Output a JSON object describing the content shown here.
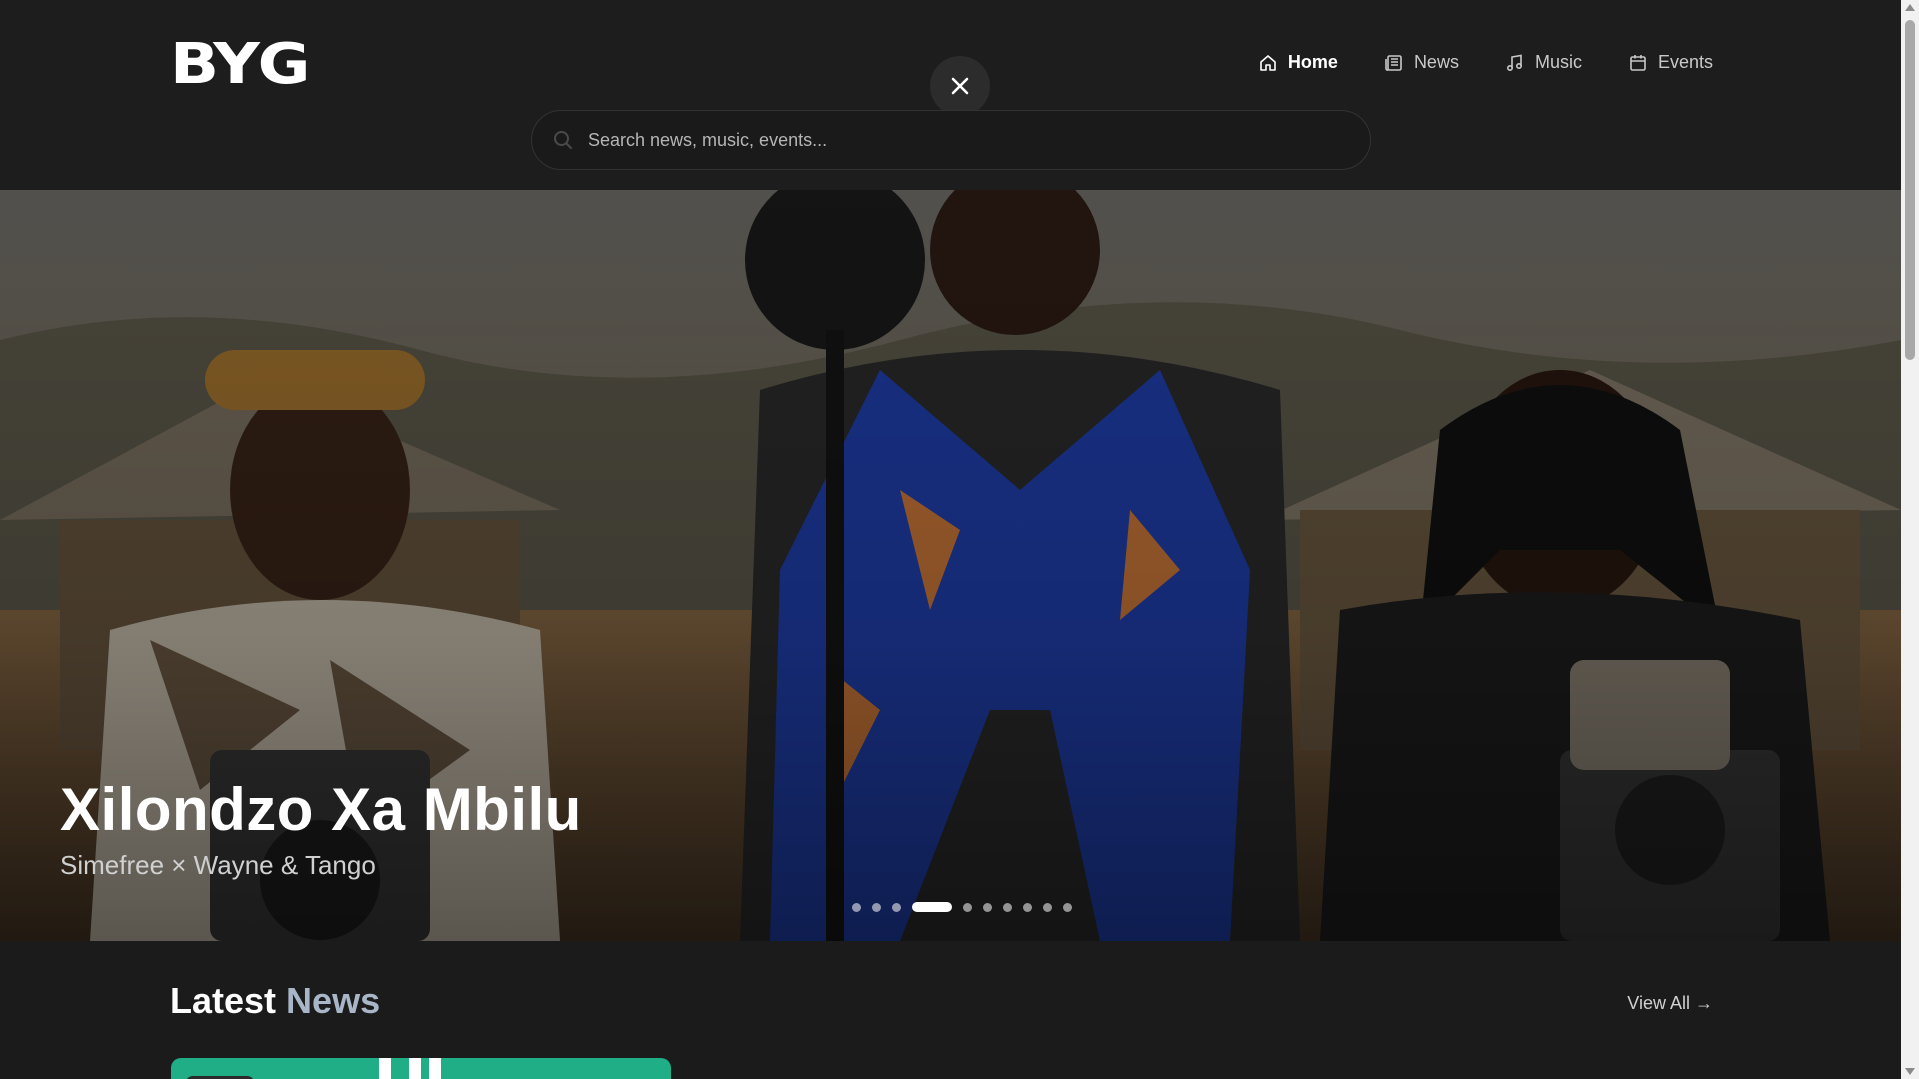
{
  "brand": {
    "logo": "BYG"
  },
  "nav": {
    "items": [
      {
        "label": "Home",
        "icon": "home-icon",
        "active": true
      },
      {
        "label": "News",
        "icon": "newspaper-icon",
        "active": false
      },
      {
        "label": "Music",
        "icon": "music-note-icon",
        "active": false
      },
      {
        "label": "Events",
        "icon": "calendar-icon",
        "active": false
      }
    ]
  },
  "search": {
    "placeholder": "Search news, music, events...",
    "value": ""
  },
  "hero": {
    "title": "Xilondzo Xa Mbilu",
    "subtitle": "Simefree × Wayne & Tango",
    "slide_count": 10,
    "active_slide_index": 3
  },
  "latest": {
    "title_main": "Latest",
    "title_accent": "News",
    "view_all": "View All →"
  },
  "colors": {
    "background": "#1b1b1b",
    "accent_text": "#a8b6c8",
    "news_card": "#1fae86"
  }
}
